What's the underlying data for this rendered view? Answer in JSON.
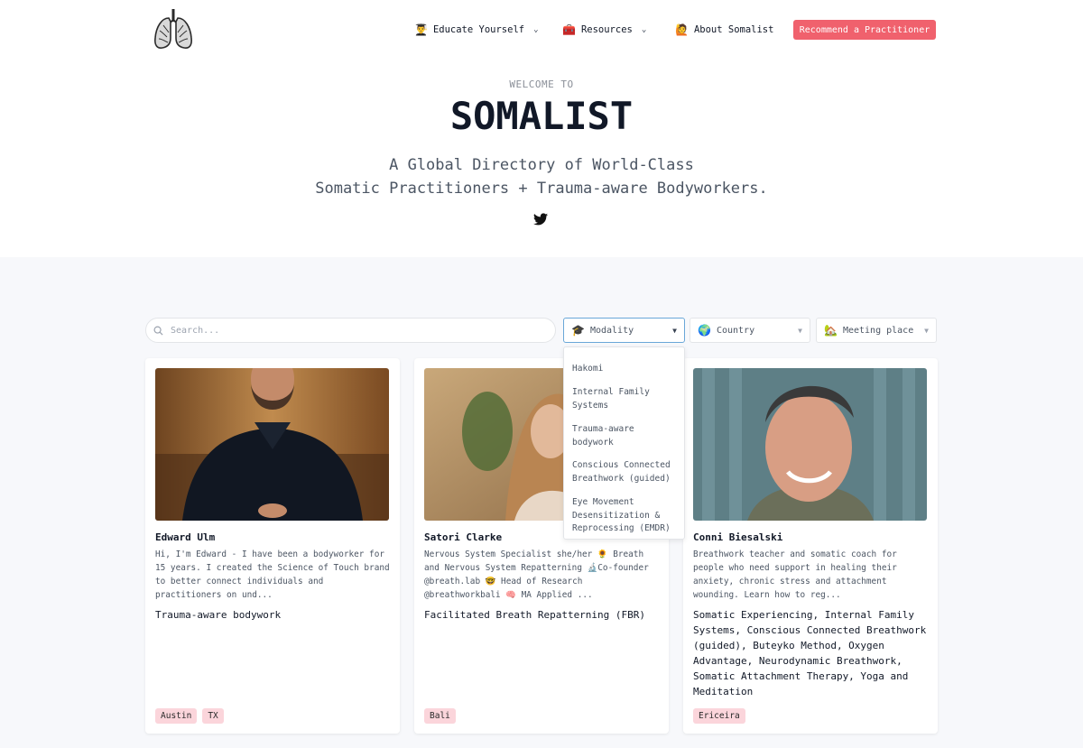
{
  "nav": {
    "items": [
      {
        "emoji": "👨‍🎓",
        "label": "Educate Yourself",
        "has_menu": true
      },
      {
        "emoji": "🧰",
        "label": "Resources",
        "has_menu": true
      },
      {
        "emoji": "🙋",
        "label": "About Somalist",
        "has_menu": false
      }
    ],
    "cta_label": "Recommend a Practitioner",
    "cta_color": "#f0616d"
  },
  "hero": {
    "welcome": "WELCOME TO",
    "title": "SOMALIST",
    "tagline_line1": "A Global Directory of World-Class",
    "tagline_line2": "Somatic Practitioners + Trauma-aware Bodyworkers.",
    "social_icon": "twitter-icon"
  },
  "filters": {
    "search_placeholder": "Search...",
    "modality": {
      "emoji": "🎓",
      "label": "Modality"
    },
    "country": {
      "emoji": "🌍",
      "label": "Country"
    },
    "meeting": {
      "emoji": "🏡",
      "label": "Meeting place"
    },
    "dropdown_options": [
      "Hakomi",
      "Internal Family Systems",
      "Trauma-aware bodywork",
      "Conscious Connected Breathwork (guided)",
      "Eye Movement Desensitization & Reprocessing (EMDR)"
    ]
  },
  "cards": [
    {
      "name": "Edward Ulm",
      "bio": "Hi, I'm Edward - I have been a bodyworker for 15 years. I created the Science of Touch brand to better connect individuals and practitioners on und...",
      "modalities": "Trauma-aware bodywork",
      "tags": [
        "Austin",
        "TX"
      ]
    },
    {
      "name": "Satori Clarke",
      "bio": "Nervous System Specialist she/her 🌻 Breath and Nervous System Repatterning 🔬Co-founder @breath.lab 🤓 Head of Research @breathworkbali 🧠 MA Applied ...",
      "modalities": "Facilitated Breath Repatterning (FBR)",
      "tags": [
        "Bali"
      ]
    },
    {
      "name": "Conni Biesalski",
      "bio": "Breathwork teacher and somatic coach for people who need support in healing their anxiety, chronic stress and attachment wounding. Learn how to reg...",
      "modalities": "Somatic Experiencing, Internal Family Systems, Conscious Connected Breathwork (guided), Buteyko Method, Oxygen Advantage, Neurodynamic Breathwork, Somatic Attachment Therapy, Yoga and Meditation",
      "tags": [
        "Ericeira"
      ]
    }
  ],
  "colors": {
    "tag_bg": "#fbd5db",
    "main_bg": "#f7f8fb",
    "active_border": "#6aa7d8"
  }
}
